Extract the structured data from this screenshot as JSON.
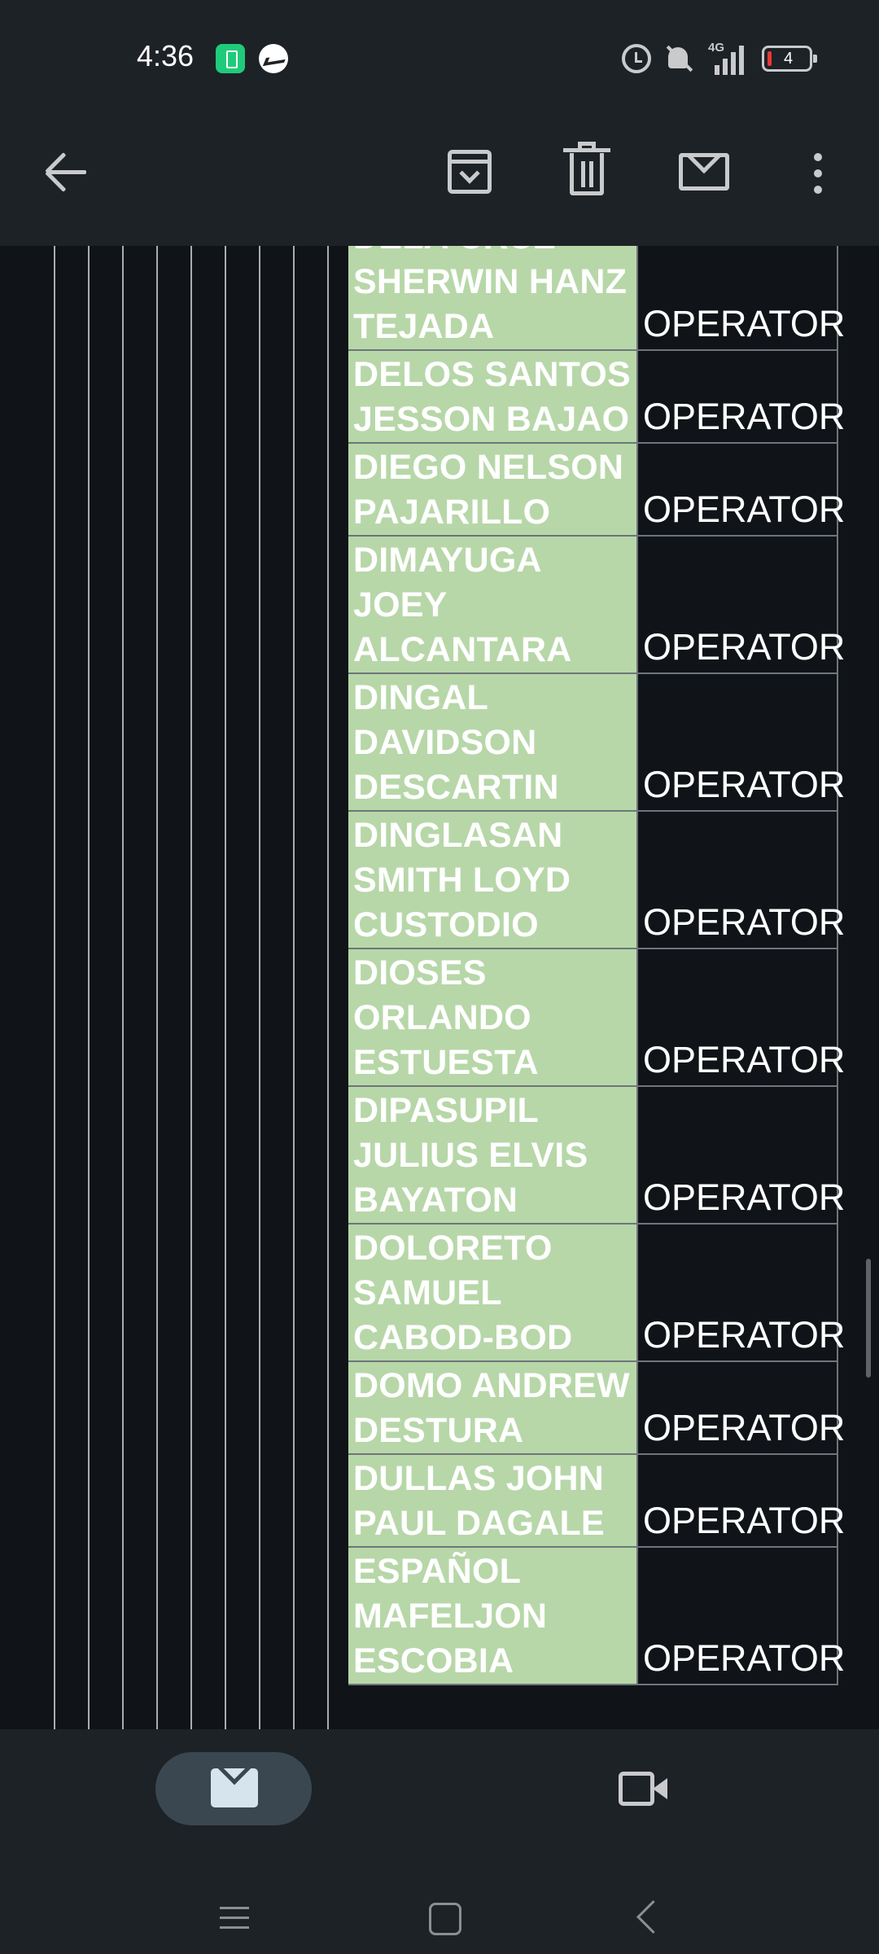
{
  "status_bar": {
    "time": "4:36",
    "network": "4G",
    "battery": "4"
  },
  "toolbar": {
    "icons": [
      "back-icon",
      "archive-icon",
      "delete-icon",
      "mail-icon",
      "more-icon"
    ]
  },
  "sheet": {
    "rows": [
      {
        "name": "DELA CRUZ SHERWIN HANZ TEJADA",
        "lines": [
          "DELA CRUZ",
          "SHERWIN HANZ",
          "TEJADA"
        ],
        "position": "OPERATOR"
      },
      {
        "name": "DELOS SANTOS JESSON BAJAO",
        "lines": [
          "DELOS SANTOS",
          "JESSON BAJAO"
        ],
        "position": "OPERATOR"
      },
      {
        "name": "DIEGO NELSON PAJARILLO",
        "lines": [
          "DIEGO NELSON",
          "PAJARILLO"
        ],
        "position": "OPERATOR"
      },
      {
        "name": "DIMAYUGA JOEY ALCANTARA",
        "lines": [
          "DIMAYUGA",
          "JOEY",
          "ALCANTARA"
        ],
        "position": "OPERATOR"
      },
      {
        "name": "DINGAL DAVIDSON DESCARTIN",
        "lines": [
          "DINGAL",
          "DAVIDSON",
          "DESCARTIN"
        ],
        "position": "OPERATOR"
      },
      {
        "name": "DINGLASAN SMITH LOYD CUSTODIO",
        "lines": [
          "DINGLASAN",
          "SMITH LOYD",
          "CUSTODIO"
        ],
        "position": "OPERATOR"
      },
      {
        "name": "DIOSES ORLANDO ESTUESTA",
        "lines": [
          "DIOSES",
          "ORLANDO",
          "ESTUESTA"
        ],
        "position": "OPERATOR"
      },
      {
        "name": "DIPASUPIL JULIUS ELVIS BAYATON",
        "lines": [
          "DIPASUPIL",
          "JULIUS ELVIS",
          "BAYATON"
        ],
        "position": "OPERATOR"
      },
      {
        "name": "DOLORETO SAMUEL CABOD-BOD",
        "lines": [
          "DOLORETO",
          "SAMUEL",
          "CABOD-BOD"
        ],
        "position": "OPERATOR"
      },
      {
        "name": "DOMO ANDREW DESTURA",
        "lines": [
          "DOMO ANDREW",
          "DESTURA"
        ],
        "position": "OPERATOR"
      },
      {
        "name": "DULLAS JOHN PAUL DAGALE",
        "lines": [
          "DULLAS JOHN",
          "PAUL DAGALE"
        ],
        "position": "OPERATOR"
      },
      {
        "name": "ESPAÑOL MAFELJON ESCOBIA",
        "lines": [
          "ESPAÑOL",
          "MAFELJON",
          "ESCOBIA"
        ],
        "position": "OPERATOR"
      }
    ]
  },
  "bottom_nav": {
    "items": [
      "mail-icon",
      "meet-icon"
    ]
  },
  "colors": {
    "name_cell_bg": "#b7d7a8",
    "sheet_bg": "#101418",
    "chrome_bg": "#1d2227"
  }
}
